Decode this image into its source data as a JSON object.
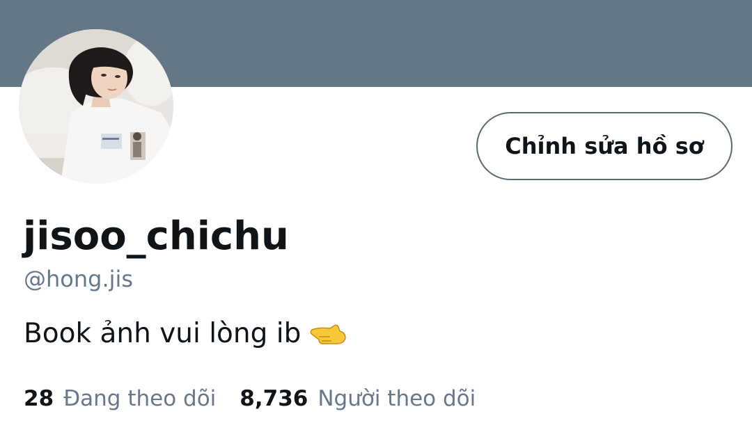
{
  "profile": {
    "display_name": "jisoo_chichu",
    "handle": "@hong.jis",
    "bio": "Book ảnh vui lòng ib",
    "bio_emoji": "pointing-hand-emoji",
    "edit_button_label": "Chỉnh sửa hồ sơ",
    "avatar": "profile-photo"
  },
  "stats": {
    "following_count": "28",
    "following_label": "Đang theo dõi",
    "followers_count": "8,736",
    "followers_label": "Người theo dõi"
  },
  "colors": {
    "banner": "#657787",
    "text_primary": "#0f1419",
    "text_secondary": "#68778a",
    "button_border": "#5a6872"
  }
}
